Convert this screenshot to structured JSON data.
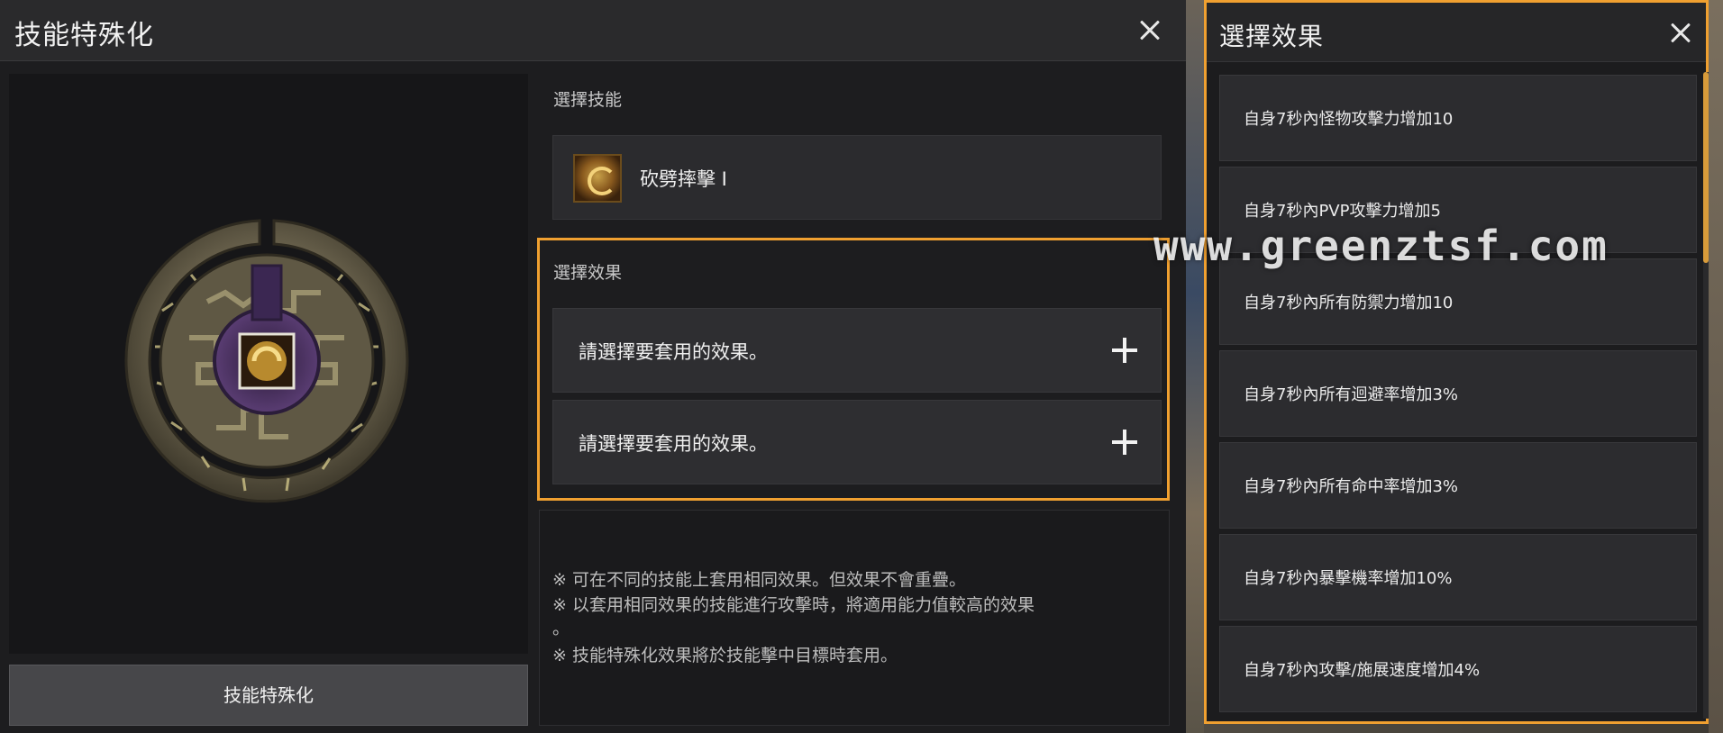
{
  "main": {
    "title": "技能特殊化",
    "skill_section_label": "選擇技能",
    "skill_name": "砍劈摔擊 I",
    "effect_section_label": "選擇效果",
    "effect_slots": [
      "請選擇要套用的效果。",
      "請選擇要套用的效果。"
    ],
    "notes": [
      "※ 可在不同的技能上套用相同效果。但效果不會重疊。",
      "※ 以套用相同效果的技能進行攻擊時，將適用能力值較高的效果",
      "。",
      "※ 技能特殊化效果將於技能擊中目標時套用。"
    ],
    "spec_button_label": "技能特殊化",
    "skill_icon": "slash-skill-icon",
    "emblem_icon": "rune-emblem-icon"
  },
  "effect_panel": {
    "title": "選擇效果",
    "options": [
      "自身7秒內怪物攻擊力增加10",
      "自身7秒內PVP攻擊力增加5",
      "自身7秒內所有防禦力增加10",
      "自身7秒內所有迴避率增加3%",
      "自身7秒內所有命中率增加3%",
      "自身7秒內暴擊機率增加10%",
      "自身7秒內攻擊/施展速度增加4%"
    ]
  },
  "watermark": "www.greenztsf.com",
  "colors": {
    "highlight": "#f0a030",
    "panel_bg": "#1d1d1f",
    "row_bg": "#2b2b2e"
  }
}
